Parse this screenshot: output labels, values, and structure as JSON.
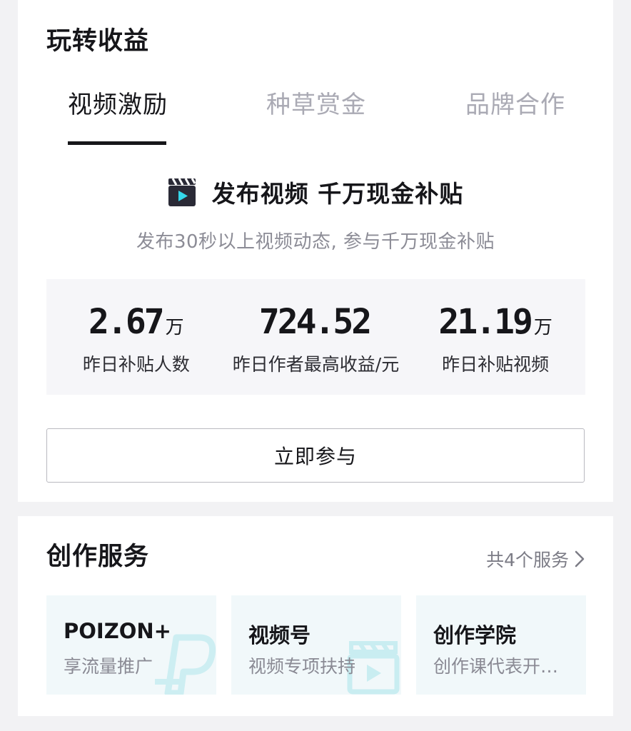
{
  "earn": {
    "title": "玩转收益",
    "tabs": [
      {
        "label": "视频激励",
        "active": true
      },
      {
        "label": "种草赏金",
        "active": false
      },
      {
        "label": "品牌合作",
        "active": false
      }
    ],
    "promo": {
      "icon": "clapperboard-icon",
      "title": "发布视频 千万现金补贴",
      "subtitle": "发布30秒以上视频动态, 参与千万现金补贴"
    },
    "stats": [
      {
        "value": "2.67",
        "unit": "万",
        "label": "昨日补贴人数"
      },
      {
        "value": "724.52",
        "unit": "",
        "label": "昨日作者最高收益/元"
      },
      {
        "value": "21.19",
        "unit": "万",
        "label": "昨日补贴视频"
      }
    ],
    "join_label": "立即参与"
  },
  "services": {
    "title": "创作服务",
    "count_label": "共4个服务",
    "items": [
      {
        "title": "POIZON+",
        "subtitle": "享流量推广",
        "icon": "poizon-p-icon"
      },
      {
        "title": "视频号",
        "subtitle": "视频专项扶持",
        "icon": "clapperboard-icon"
      },
      {
        "title": "创作学院",
        "subtitle": "创作课代表开…",
        "icon": ""
      }
    ]
  },
  "colors": {
    "text": "#16161a",
    "muted": "#aaaab4",
    "stats_bg": "#f6f6f9",
    "tile_bg": "#f1f8fa",
    "page_bg": "#f2f2f4"
  }
}
